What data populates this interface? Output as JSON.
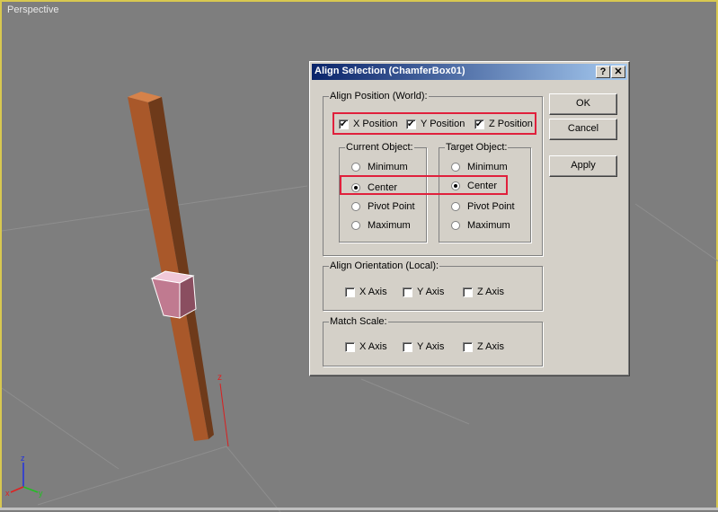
{
  "viewport": {
    "label": "Perspective",
    "axis_z_label": "z",
    "gizmo": {
      "x_label": "x",
      "y_label": "y",
      "z_label": "z"
    }
  },
  "dialog": {
    "title": "Align Selection (ChamferBox01)",
    "help_label": "?",
    "close_label": "✕",
    "align_position": {
      "label": "Align Position (World):",
      "checks": [
        {
          "label": "X Position",
          "checked": true
        },
        {
          "label": "Y Position",
          "checked": true
        },
        {
          "label": "Z Position",
          "checked": true
        }
      ],
      "current_object": {
        "label": "Current Object:",
        "options": [
          {
            "label": "Minimum",
            "selected": false
          },
          {
            "label": "Center",
            "selected": true
          },
          {
            "label": "Pivot Point",
            "selected": false
          },
          {
            "label": "Maximum",
            "selected": false
          }
        ]
      },
      "target_object": {
        "label": "Target Object:",
        "options": [
          {
            "label": "Minimum",
            "selected": false
          },
          {
            "label": "Center",
            "selected": true
          },
          {
            "label": "Pivot Point",
            "selected": false
          },
          {
            "label": "Maximum",
            "selected": false
          }
        ]
      }
    },
    "align_orientation": {
      "label": "Align Orientation (Local):",
      "checks": [
        {
          "label": "X Axis",
          "checked": false
        },
        {
          "label": "Y Axis",
          "checked": false
        },
        {
          "label": "Z Axis",
          "checked": false
        }
      ]
    },
    "match_scale": {
      "label": "Match Scale:",
      "checks": [
        {
          "label": "X Axis",
          "checked": false
        },
        {
          "label": "Y Axis",
          "checked": false
        },
        {
          "label": "Z Axis",
          "checked": false
        }
      ]
    },
    "buttons": {
      "ok": "OK",
      "cancel": "Cancel",
      "apply": "Apply"
    }
  },
  "colors": {
    "highlight": "#e0203c",
    "viewport_bg": "#7e7e7e",
    "title_start": "#0a246a",
    "title_end": "#a6caf0",
    "rod": "#a0522d",
    "box": "#c07a90"
  }
}
